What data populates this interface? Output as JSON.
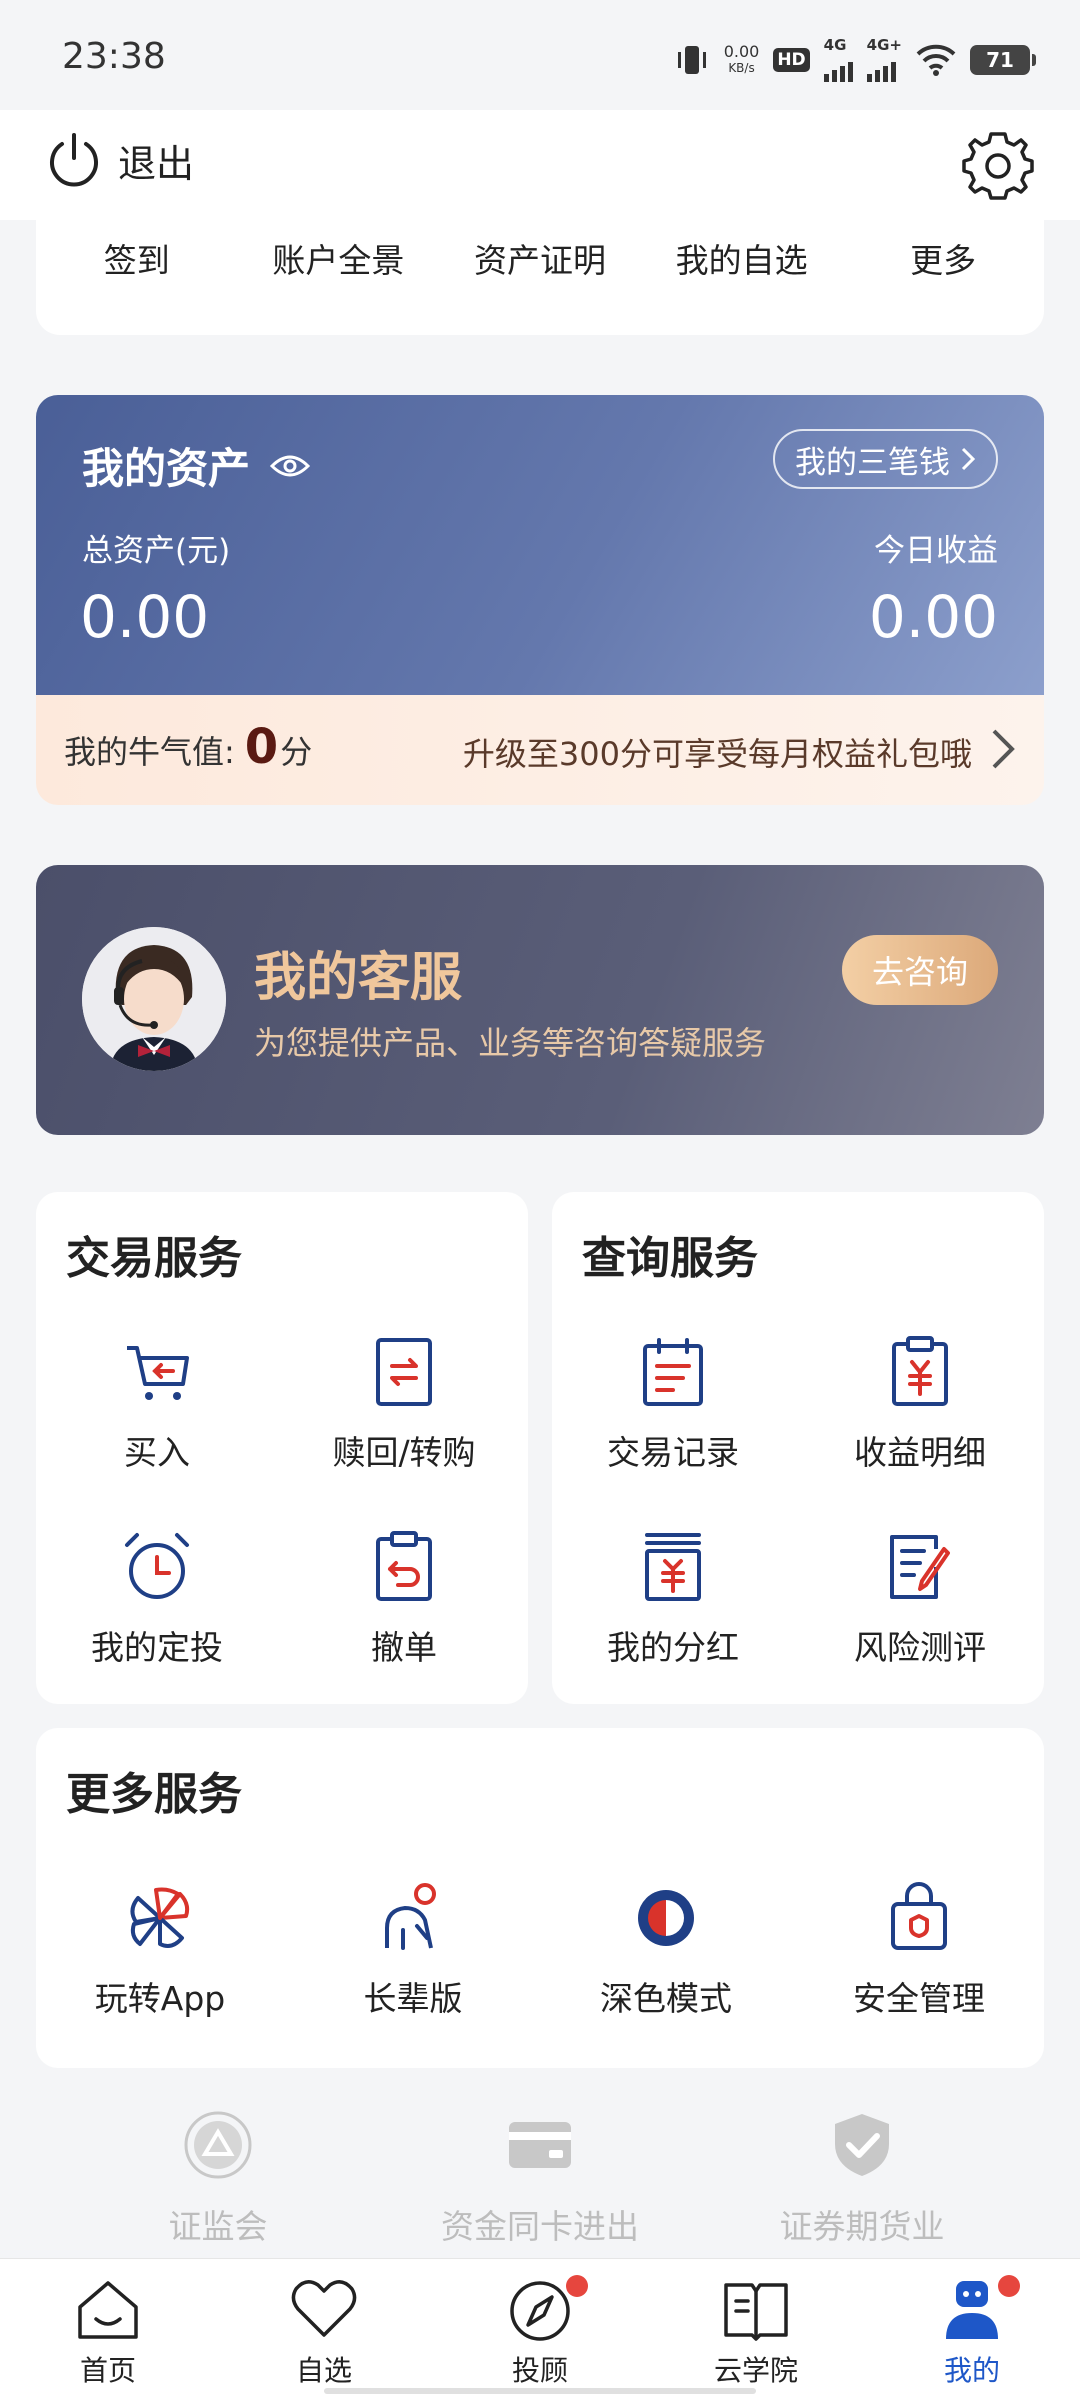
{
  "status_bar": {
    "time": "23:38",
    "net_speed_value": "0.00",
    "net_speed_unit": "KB/s",
    "hd_label": "HD",
    "sim1_label": "4G",
    "sim2_label": "4G+",
    "battery": "71"
  },
  "topbar": {
    "logout_label": "退出"
  },
  "quick_links": [
    "签到",
    "账户全景",
    "资产证明",
    "我的自选",
    "更多"
  ],
  "assets": {
    "title": "我的资产",
    "three_money_label": "我的三笔钱",
    "total_label": "总资产(元)",
    "total_value": "0.00",
    "today_label": "今日收益",
    "today_value": "0.00"
  },
  "bull": {
    "label": "我的牛气值:",
    "value": "0",
    "unit": "分",
    "promo": "升级至300分可享受每月权益礼包哦"
  },
  "customer_service": {
    "title": "我的客服",
    "subtitle": "为您提供产品、业务等咨询答疑服务",
    "button": "去咨询"
  },
  "trade_services": {
    "title": "交易服务",
    "items": [
      "买入",
      "赎回/转购",
      "我的定投",
      "撤单"
    ]
  },
  "query_services": {
    "title": "查询服务",
    "items": [
      "交易记录",
      "收益明细",
      "我的分红",
      "风险测评"
    ]
  },
  "more_services": {
    "title": "更多服务",
    "items": [
      "玩转App",
      "长辈版",
      "深色模式",
      "安全管理"
    ]
  },
  "regulatory": [
    "证监会",
    "资金同卡进出",
    "证券期货业"
  ],
  "tabs": [
    "首页",
    "自选",
    "投顾",
    "云学院",
    "我的"
  ],
  "colors": {
    "primary_blue": "#1e57c8",
    "icon_navy": "#1f3f86",
    "icon_red": "#d9332b",
    "asset_card": "#5b6fa6",
    "gold_text": "#f0c79c",
    "badge_red": "#e6463e"
  }
}
